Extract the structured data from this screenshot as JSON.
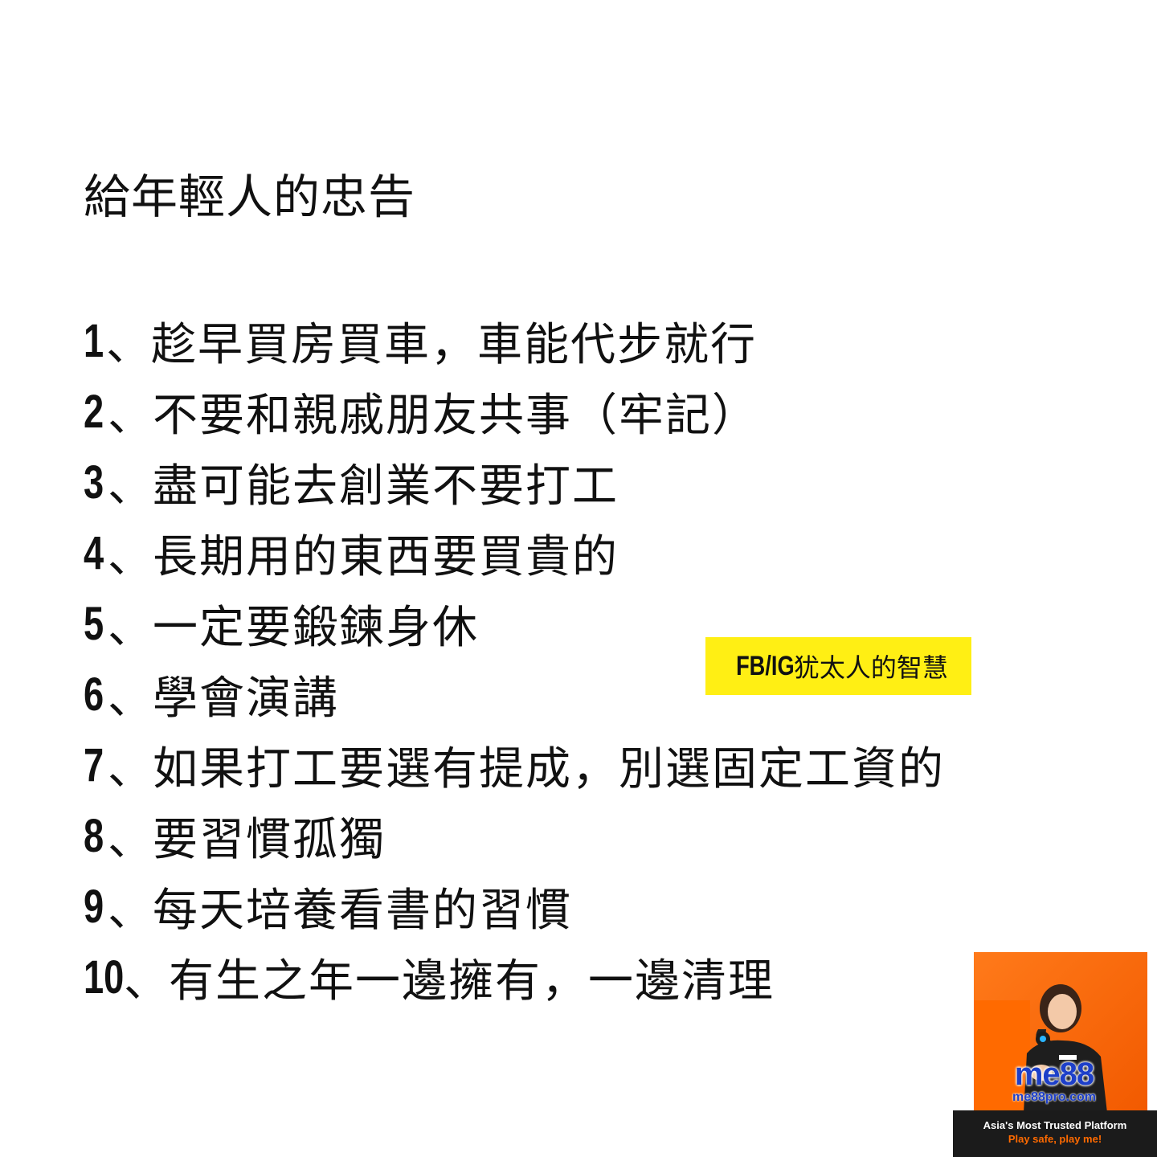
{
  "title": "給年輕人的忠告",
  "separator": "、",
  "items": [
    {
      "num": "1",
      "text": "趁早買房買車，車能代步就行"
    },
    {
      "num": "2",
      "text": "不要和親戚朋友共事（牢記）"
    },
    {
      "num": "3",
      "text": "盡可能去創業不要打工"
    },
    {
      "num": "4",
      "text": "長期用的東西要買貴的"
    },
    {
      "num": "5",
      "text": "一定要鍛鍊身休"
    },
    {
      "num": "6",
      "text": "學會演講"
    },
    {
      "num": "7",
      "text": "如果打工要選有提成，別選固定工資的"
    },
    {
      "num": "8",
      "text": "要習慣孤獨"
    },
    {
      "num": "9",
      "text": "每天培養看書的習慣"
    },
    {
      "num": "10",
      "text": "有生之年一邊擁有，一邊清理"
    }
  ],
  "tag": {
    "prefix": "FB/IG",
    "name": "犹太人的智慧",
    "background": "#ffef14"
  },
  "ad": {
    "logo": "me88",
    "site": "me88pro.com",
    "tagline": "Asia's Most Trusted Platform",
    "slogan": "Play safe, play me!",
    "accent": "#ff6a00",
    "brand": "#1d3fc9"
  }
}
